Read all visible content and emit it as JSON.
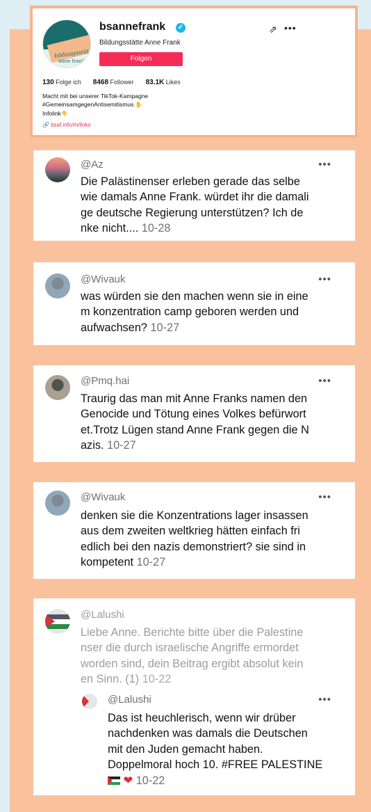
{
  "profile": {
    "handle": "bsannefrank",
    "display_name": "Bildungsstätte Anne Frank",
    "follow_label": "Folgen",
    "avatar_text_1": "bildungsstätte",
    "avatar_text_2": "anne frank",
    "stats": {
      "following_value": "130",
      "following_label": "Folge ich",
      "followers_value": "8468",
      "followers_label": "Follower",
      "likes_value": "83.1K",
      "likes_label": "Likes"
    },
    "bio_line_1": "Macht mit bei unserer TikTok-Kampagne",
    "bio_line_2": "#GemeinsamgegenAntisemitismus",
    "bio_line_3": "Infolink",
    "link": "bsaf.info/m/links",
    "verified_icon": "checkmark-icon",
    "accent_color": "#f52b58"
  },
  "comments": [
    {
      "user": "@Az",
      "lines": [
        "Die Palästinenser erleben gerade das selbe",
        "wie damals Anne Frank. würdet ihr die damali",
        "ge deutsche Regierung unterstützen? Ich de",
        "nke nicht...."
      ],
      "date": "10-28"
    },
    {
      "user": "@Wivauk",
      "lines": [
        "was würden sie den machen wenn sie in eine",
        "m konzentration camp geboren werden und",
        "aufwachsen?"
      ],
      "date": "10-27"
    },
    {
      "user": "@Pmq.hai",
      "lines": [
        "Traurig das man mit Anne Franks namen den",
        "Genocide und Tötung eines Volkes befürwort",
        "et.Trotz Lügen stand Anne Frank gegen die N",
        "azis."
      ],
      "date": "10-27"
    },
    {
      "user": "@Wivauk",
      "lines": [
        "denken sie die Konzentrations lager insassen",
        "aus dem zweiten weltkrieg hätten einfach fri",
        "edlich bei den nazis demonstriert? sie sind in",
        "kompetent"
      ],
      "date": "10-27"
    },
    {
      "user": "@Lalushi",
      "lines": [
        "Liebe Anne. Berichte bitte über die Palestine",
        "nser die durch israelische Angriffe ermordet",
        "worden sind, dein Beitrag ergibt absolut kein",
        "en Sinn. (1)"
      ],
      "date": "10-22",
      "reply": {
        "user": "@Lalushi",
        "lines": [
          "Das ist heuchlerisch, wenn wir drüber",
          "nachdenken was damals die Deutschen",
          "mit den Juden gemacht haben.",
          "Doppelmoral hoch 10. #FREE PALESTINE"
        ],
        "date": "10-22"
      }
    }
  ],
  "icons": {
    "share": "share-icon",
    "more": "more-icon",
    "heart": "heart-icon",
    "flag": "palestine-flag-icon",
    "hand": "pointing-hand-icon"
  }
}
